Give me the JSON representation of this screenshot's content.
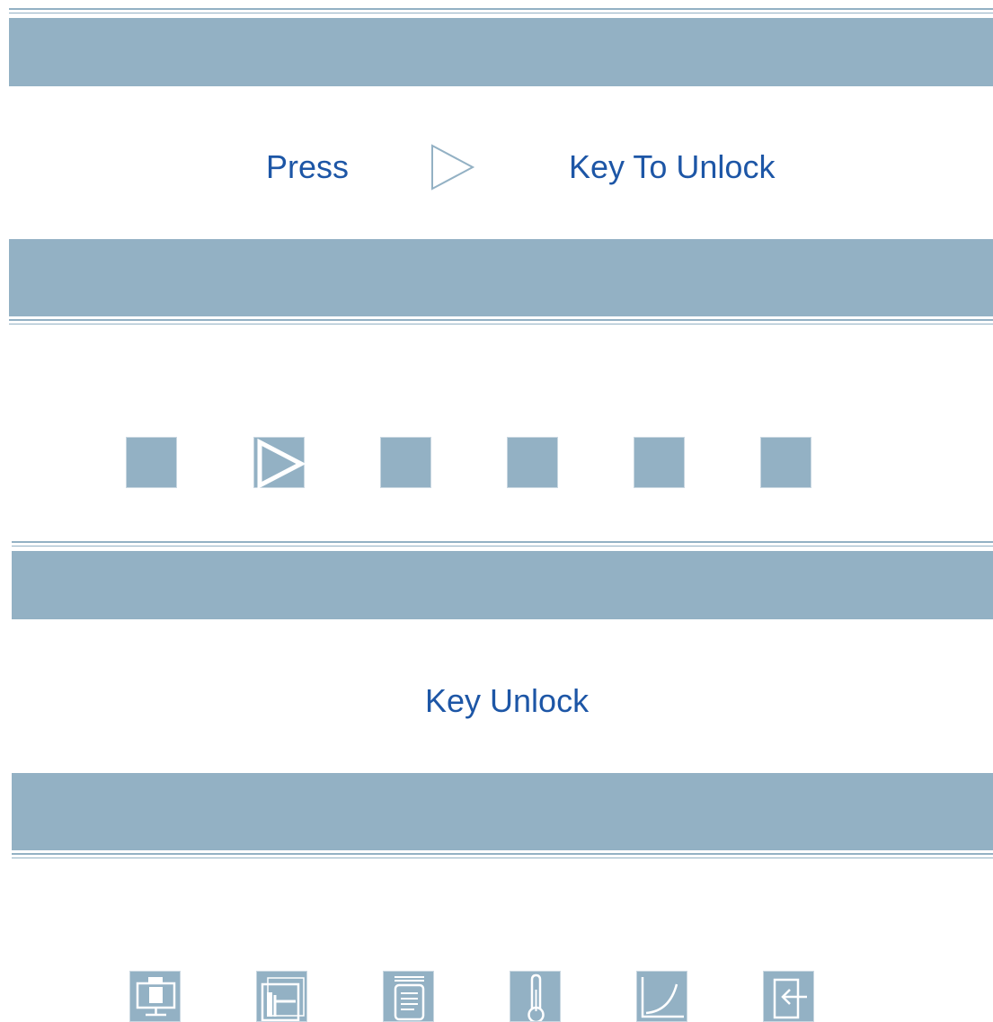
{
  "screen1": {
    "message_left": "Press",
    "arrow_icon": "play-arrow-outline-icon",
    "message_right": "Key To Unlock"
  },
  "keypad": {
    "keys": [
      {
        "icon": "none",
        "active": false
      },
      {
        "icon": "play-arrow-icon",
        "active": true
      },
      {
        "icon": "none",
        "active": false
      },
      {
        "icon": "none",
        "active": false
      },
      {
        "icon": "none",
        "active": false
      },
      {
        "icon": "none",
        "active": false
      }
    ]
  },
  "screen2": {
    "message": "Key Unlock"
  },
  "function_keys": [
    {
      "icon": "monitor-icon"
    },
    {
      "icon": "layout-icon"
    },
    {
      "icon": "document-icon"
    },
    {
      "icon": "thermometer-icon"
    },
    {
      "icon": "curve-chart-icon"
    },
    {
      "icon": "exit-icon"
    }
  ],
  "colors": {
    "band": "#93b1c4",
    "text": "#1d56a6",
    "background": "#ffffff"
  }
}
